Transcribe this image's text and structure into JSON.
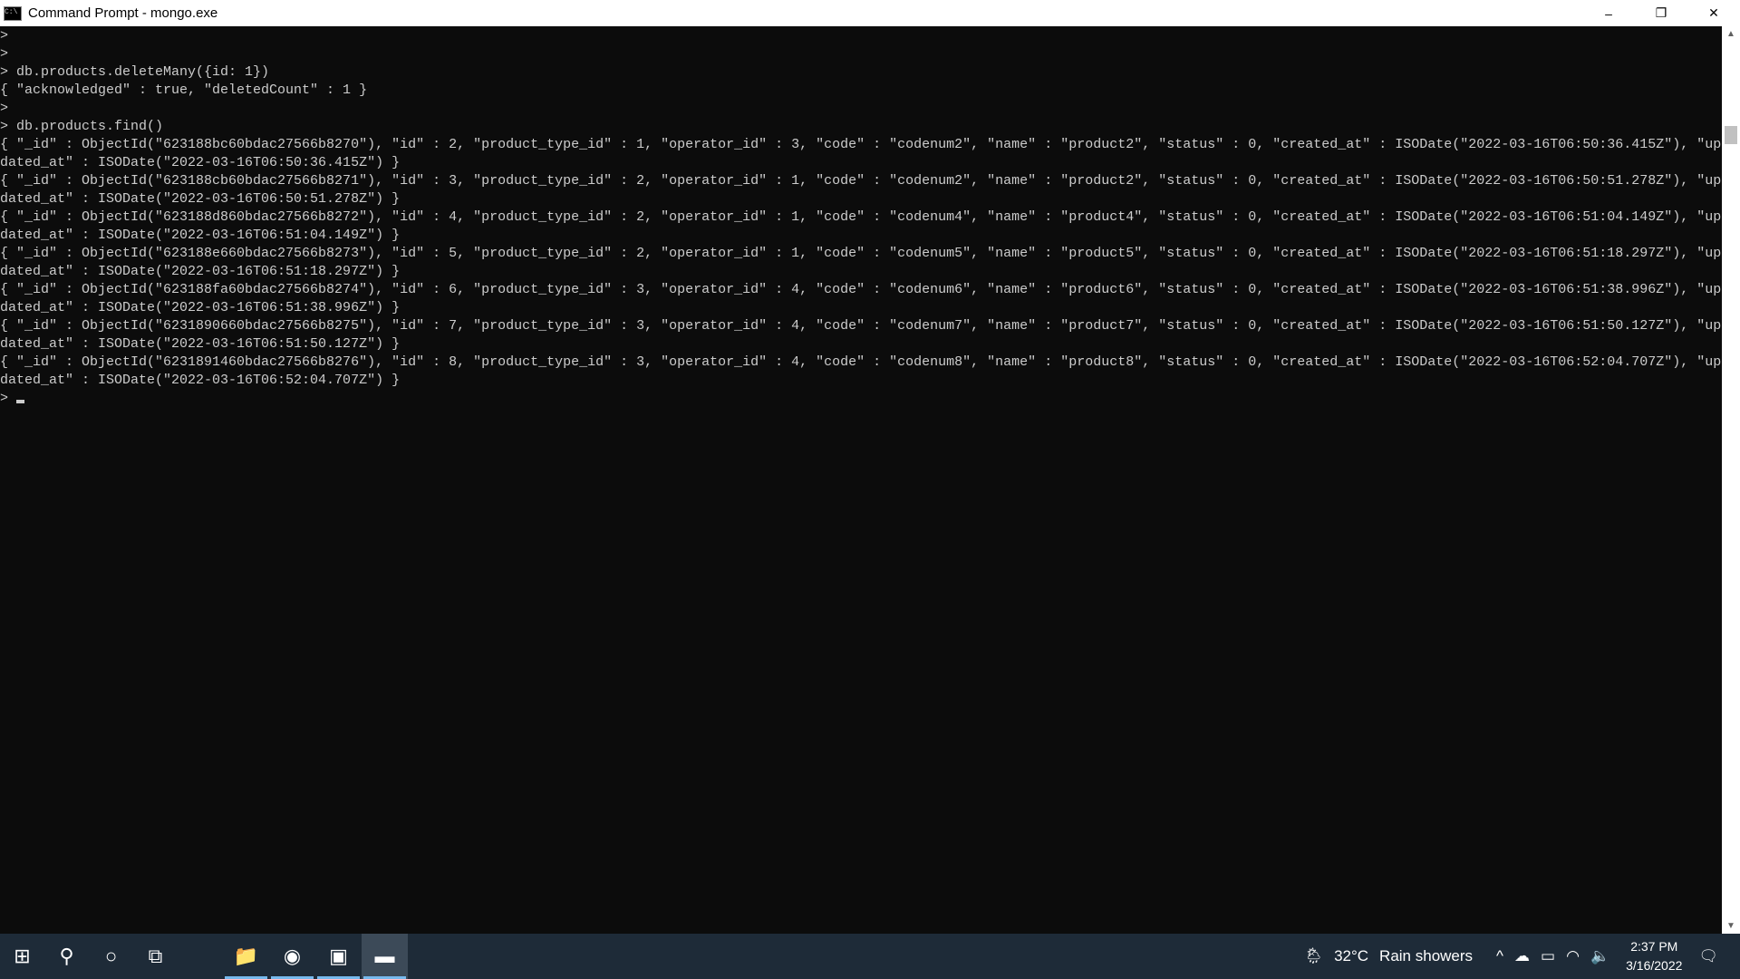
{
  "window": {
    "title": "Command Prompt - mongo.exe",
    "minimize": "–",
    "maximize": "❐",
    "close": "✕"
  },
  "terminal": {
    "lines": [
      ">",
      ">",
      "> db.products.deleteMany({id: 1})",
      "{ \"acknowledged\" : true, \"deletedCount\" : 1 }",
      ">",
      "> db.products.find()",
      "{ \"_id\" : ObjectId(\"623188bc60bdac27566b8270\"), \"id\" : 2, \"product_type_id\" : 1, \"operator_id\" : 3, \"code\" : \"codenum2\", \"name\" : \"product2\", \"status\" : 0, \"created_at\" : ISODate(\"2022-03-16T06:50:36.415Z\"), \"up",
      "dated_at\" : ISODate(\"2022-03-16T06:50:36.415Z\") }",
      "{ \"_id\" : ObjectId(\"623188cb60bdac27566b8271\"), \"id\" : 3, \"product_type_id\" : 2, \"operator_id\" : 1, \"code\" : \"codenum2\", \"name\" : \"product2\", \"status\" : 0, \"created_at\" : ISODate(\"2022-03-16T06:50:51.278Z\"), \"up",
      "dated_at\" : ISODate(\"2022-03-16T06:50:51.278Z\") }",
      "{ \"_id\" : ObjectId(\"623188d860bdac27566b8272\"), \"id\" : 4, \"product_type_id\" : 2, \"operator_id\" : 1, \"code\" : \"codenum4\", \"name\" : \"product4\", \"status\" : 0, \"created_at\" : ISODate(\"2022-03-16T06:51:04.149Z\"), \"up",
      "dated_at\" : ISODate(\"2022-03-16T06:51:04.149Z\") }",
      "{ \"_id\" : ObjectId(\"623188e660bdac27566b8273\"), \"id\" : 5, \"product_type_id\" : 2, \"operator_id\" : 1, \"code\" : \"codenum5\", \"name\" : \"product5\", \"status\" : 0, \"created_at\" : ISODate(\"2022-03-16T06:51:18.297Z\"), \"up",
      "dated_at\" : ISODate(\"2022-03-16T06:51:18.297Z\") }",
      "{ \"_id\" : ObjectId(\"623188fa60bdac27566b8274\"), \"id\" : 6, \"product_type_id\" : 3, \"operator_id\" : 4, \"code\" : \"codenum6\", \"name\" : \"product6\", \"status\" : 0, \"created_at\" : ISODate(\"2022-03-16T06:51:38.996Z\"), \"up",
      "dated_at\" : ISODate(\"2022-03-16T06:51:38.996Z\") }",
      "{ \"_id\" : ObjectId(\"6231890660bdac27566b8275\"), \"id\" : 7, \"product_type_id\" : 3, \"operator_id\" : 4, \"code\" : \"codenum7\", \"name\" : \"product7\", \"status\" : 0, \"created_at\" : ISODate(\"2022-03-16T06:51:50.127Z\"), \"up",
      "dated_at\" : ISODate(\"2022-03-16T06:51:50.127Z\") }",
      "{ \"_id\" : ObjectId(\"6231891460bdac27566b8276\"), \"id\" : 8, \"product_type_id\" : 3, \"operator_id\" : 4, \"code\" : \"codenum8\", \"name\" : \"product8\", \"status\" : 0, \"created_at\" : ISODate(\"2022-03-16T06:52:04.707Z\"), \"up",
      "dated_at\" : ISODate(\"2022-03-16T06:52:04.707Z\") }"
    ],
    "prompt": "> "
  },
  "taskbar": {
    "items": [
      {
        "name": "start-button",
        "icon": "windows-icon",
        "glyph": "⊞"
      },
      {
        "name": "search-button",
        "icon": "search-icon",
        "glyph": "⚲"
      },
      {
        "name": "cortana-button",
        "icon": "cortana-icon",
        "glyph": "○"
      },
      {
        "name": "task-view-button",
        "icon": "task-view-icon",
        "glyph": "⧉"
      },
      {
        "name": "file-explorer-button",
        "icon": "folder-icon",
        "glyph": "📁",
        "running": true
      },
      {
        "name": "chrome-button",
        "icon": "chrome-icon",
        "glyph": "◉",
        "running": true
      },
      {
        "name": "app-window-button",
        "icon": "window-icon",
        "glyph": "▣",
        "running": true
      },
      {
        "name": "command-prompt-button",
        "icon": "terminal-icon",
        "glyph": "▬",
        "running": true,
        "active": true
      }
    ],
    "weather": {
      "temp": "32°C",
      "condition": "Rain showers"
    },
    "time": "2:37 PM",
    "date": "3/16/2022",
    "accent": "#76b9ed"
  }
}
